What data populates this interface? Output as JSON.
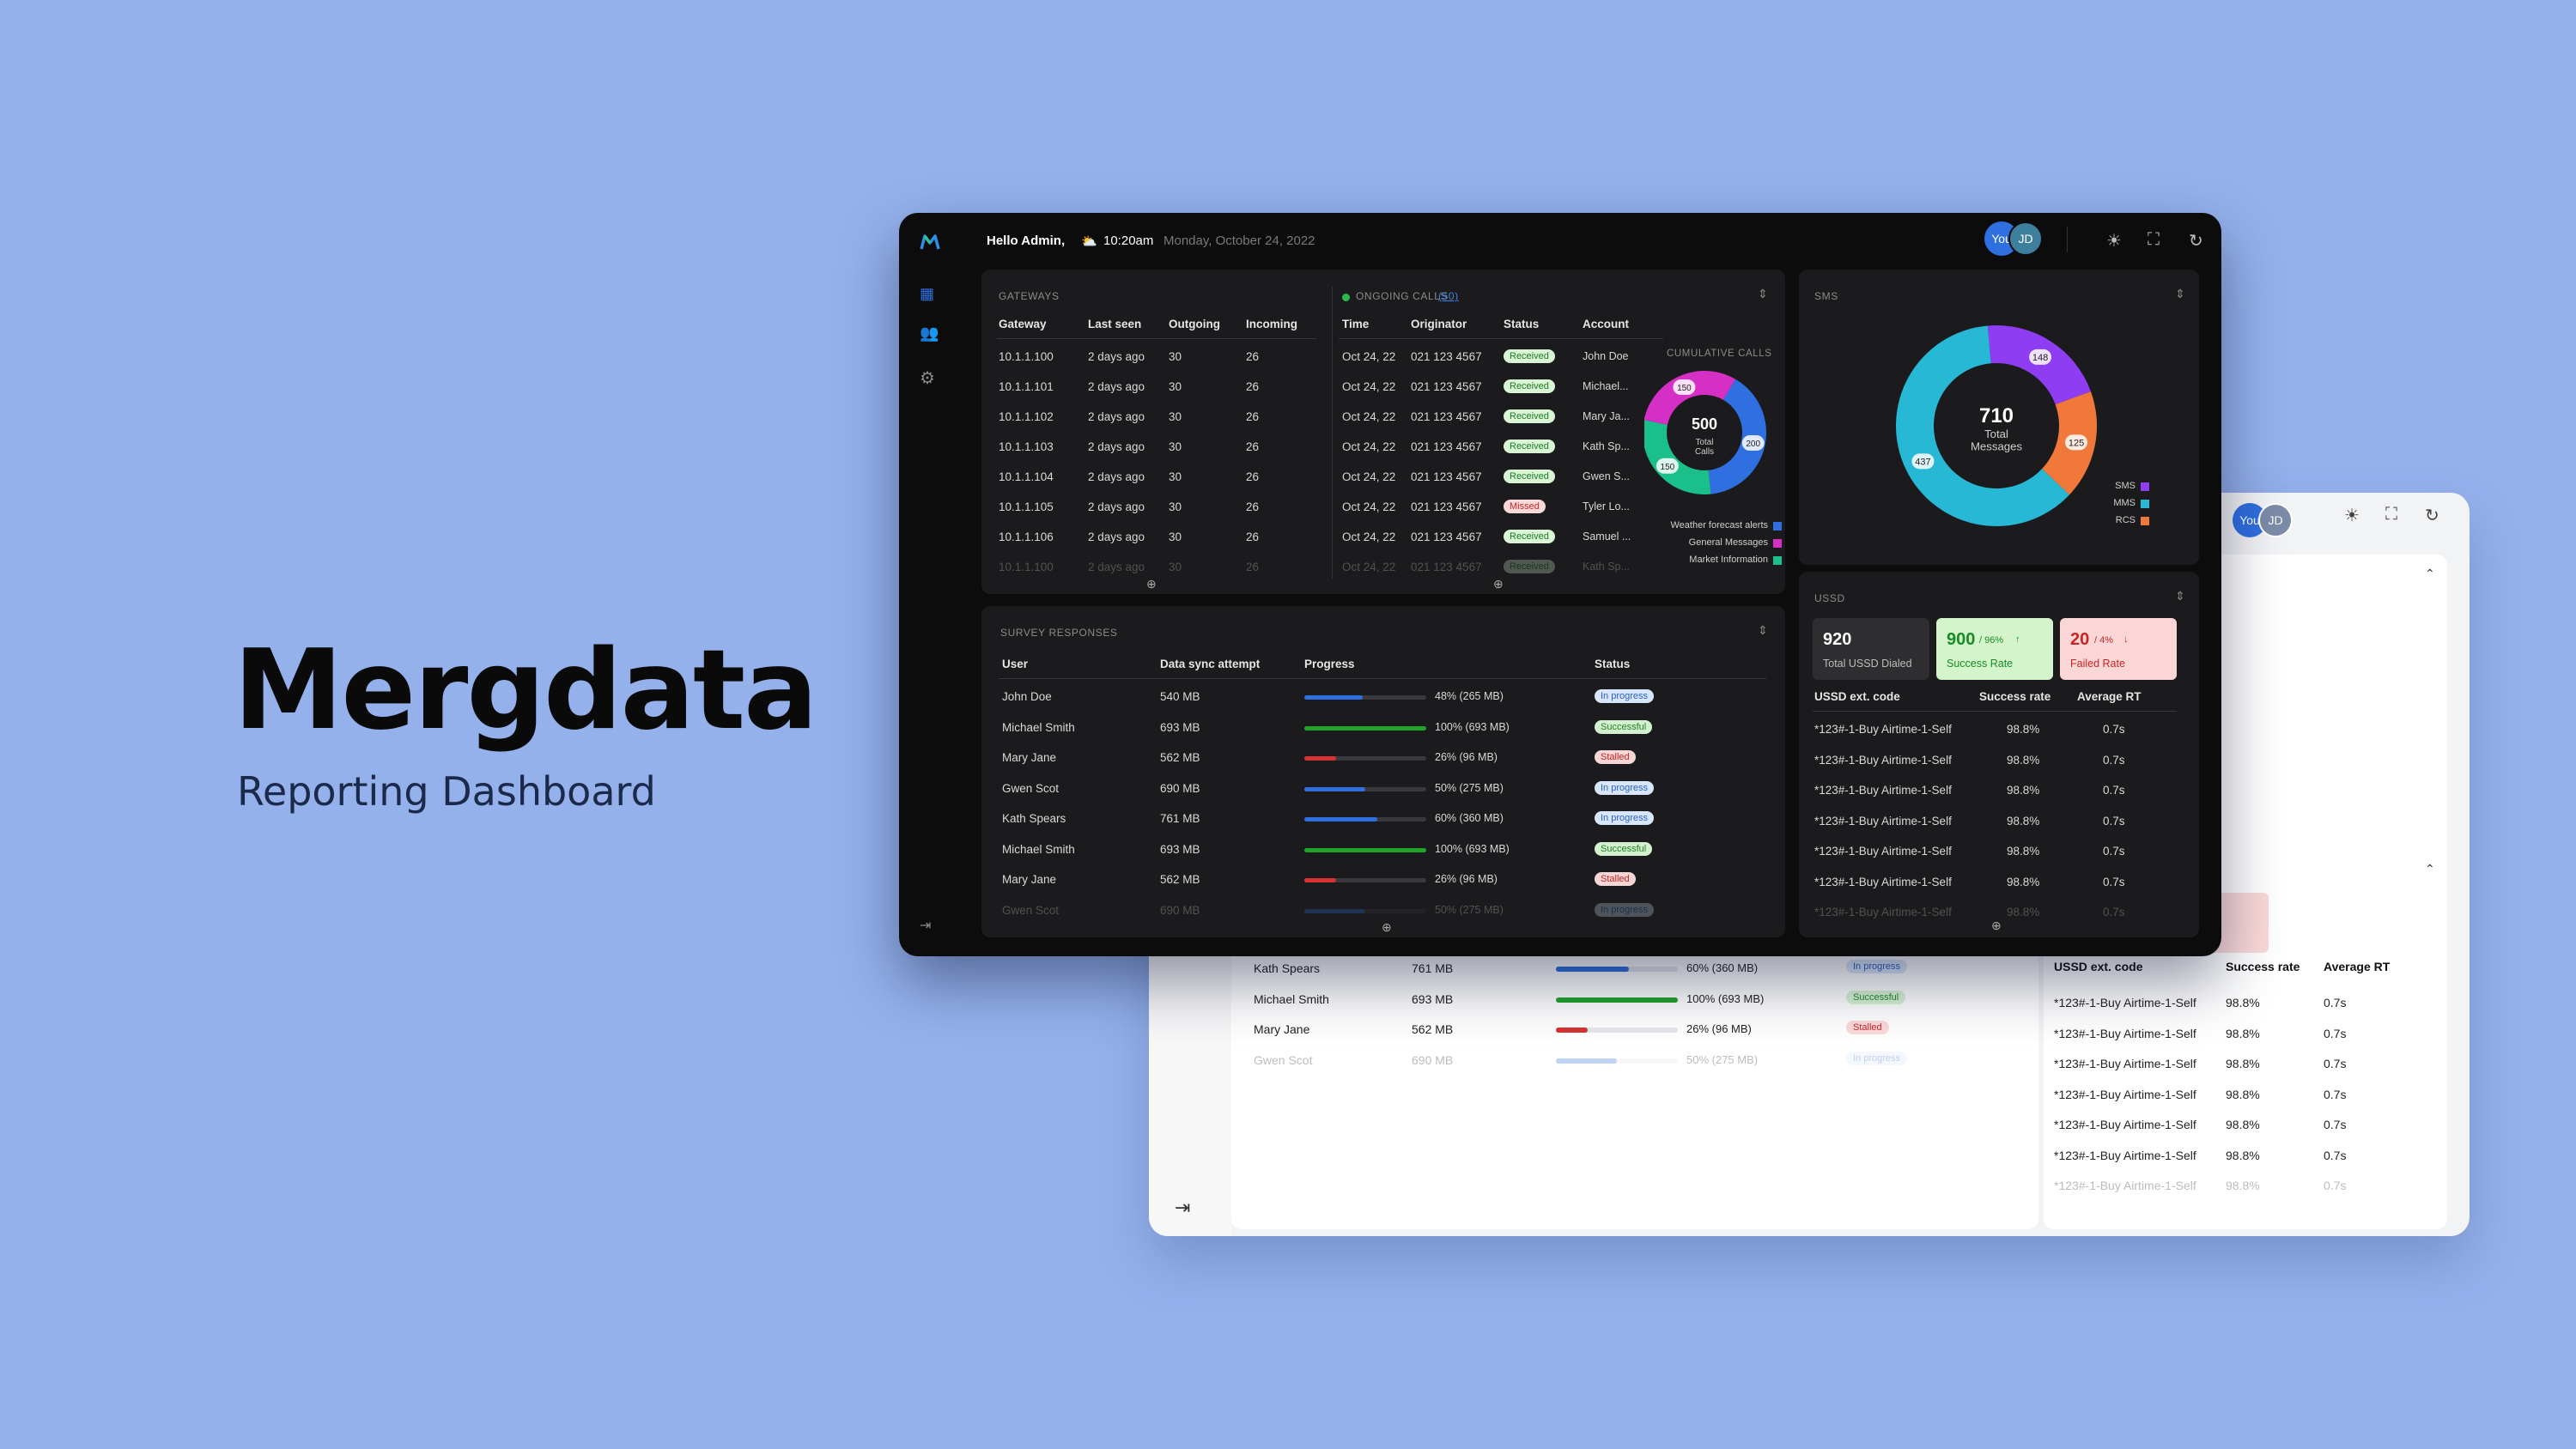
{
  "hero": {
    "title": "Mergdata",
    "subtitle": "Reporting Dashboard"
  },
  "header": {
    "greeting": "Hello Admin,",
    "weather_icon": "⛅",
    "time": "10:20am",
    "date": "Monday, October 24, 2022",
    "avatars": [
      "You",
      "JD"
    ]
  },
  "gateways": {
    "label": "GATEWAYS",
    "columns": [
      "Gateway",
      "Last seen",
      "Outgoing",
      "Incoming"
    ],
    "rows": [
      [
        "10.1.1.100",
        "2 days ago",
        "30",
        "26"
      ],
      [
        "10.1.1.101",
        "2 days ago",
        "30",
        "26"
      ],
      [
        "10.1.1.102",
        "2 days ago",
        "30",
        "26"
      ],
      [
        "10.1.1.103",
        "2 days ago",
        "30",
        "26"
      ],
      [
        "10.1.1.104",
        "2 days ago",
        "30",
        "26"
      ],
      [
        "10.1.1.105",
        "2 days ago",
        "30",
        "26"
      ],
      [
        "10.1.1.106",
        "2 days ago",
        "30",
        "26"
      ],
      [
        "10.1.1.100",
        "2 days ago",
        "30",
        "26"
      ]
    ]
  },
  "calls": {
    "label": "ONGOING CALLS",
    "count": "(50)",
    "columns": [
      "Time",
      "Originator",
      "Status",
      "Account"
    ],
    "rows": [
      [
        "Oct 24, 22",
        "021 123 4567",
        "Received",
        "John Doe"
      ],
      [
        "Oct 24, 22",
        "021 123 4567",
        "Received",
        "Michael..."
      ],
      [
        "Oct 24, 22",
        "021 123 4567",
        "Received",
        "Mary Ja..."
      ],
      [
        "Oct 24, 22",
        "021 123 4567",
        "Received",
        "Kath Sp..."
      ],
      [
        "Oct 24, 22",
        "021 123 4567",
        "Received",
        "Gwen S..."
      ],
      [
        "Oct 24, 22",
        "021 123 4567",
        "Missed",
        "Tyler Lo..."
      ],
      [
        "Oct 24, 22",
        "021 123 4567",
        "Received",
        "Samuel ..."
      ],
      [
        "Oct 24, 22",
        "021 123 4567",
        "Received",
        "Kath Sp..."
      ]
    ],
    "cumulative": {
      "label": "CUMULATIVE CALLS",
      "total": "500",
      "total_label": "Total Calls",
      "segments": [
        {
          "name": "Weather forecast alerts",
          "value": 200,
          "color": "#2f6fe0"
        },
        {
          "name": "General Messages",
          "value": 150,
          "color": "#d62fc6"
        },
        {
          "name": "Market Information",
          "value": 150,
          "color": "#1bbf8a"
        }
      ]
    }
  },
  "sms": {
    "label": "SMS",
    "total": "710",
    "total_label": "Total Messages",
    "segments": [
      {
        "name": "SMS",
        "value": 148,
        "color": "#8f3df2"
      },
      {
        "name": "MMS",
        "value": 437,
        "color": "#27b8d6"
      },
      {
        "name": "RCS",
        "value": 125,
        "color": "#f0783a"
      }
    ]
  },
  "survey": {
    "label": "SURVEY RESPONSES",
    "columns": [
      "User",
      "Data sync attempt",
      "Progress",
      "Status"
    ],
    "rows": [
      {
        "user": "John Doe",
        "size": "540 MB",
        "pct": 48,
        "progress": "48% (265 MB)",
        "status": "In progress",
        "kind": "prog"
      },
      {
        "user": "Michael Smith",
        "size": "693 MB",
        "pct": 100,
        "progress": "100% (693 MB)",
        "status": "Successful",
        "kind": "succ"
      },
      {
        "user": "Mary Jane",
        "size": "562 MB",
        "pct": 26,
        "progress": "26% (96 MB)",
        "status": "Stalled",
        "kind": "stall"
      },
      {
        "user": "Gwen Scot",
        "size": "690 MB",
        "pct": 50,
        "progress": "50% (275 MB)",
        "status": "In progress",
        "kind": "prog"
      },
      {
        "user": "Kath Spears",
        "size": "761 MB",
        "pct": 60,
        "progress": "60% (360 MB)",
        "status": "In progress",
        "kind": "prog"
      },
      {
        "user": "Michael Smith",
        "size": "693 MB",
        "pct": 100,
        "progress": "100% (693 MB)",
        "status": "Successful",
        "kind": "succ"
      },
      {
        "user": "Mary Jane",
        "size": "562 MB",
        "pct": 26,
        "progress": "26% (96 MB)",
        "status": "Stalled",
        "kind": "stall"
      },
      {
        "user": "Gwen Scot",
        "size": "690 MB",
        "pct": 50,
        "progress": "50% (275 MB)",
        "status": "In progress",
        "kind": "prog"
      }
    ]
  },
  "ussd": {
    "label": "USSD",
    "dialed": {
      "value": "920",
      "label": "Total USSD Dialed"
    },
    "success": {
      "value": "900",
      "pct": "/ 96%",
      "arrow": "↑",
      "label": "Success Rate"
    },
    "failed": {
      "value": "20",
      "pct": "/ 4%",
      "arrow": "↓",
      "label": "Failed Rate"
    },
    "columns": [
      "USSD ext. code",
      "Success rate",
      "Average RT"
    ],
    "rows": [
      [
        "*123#-1-Buy Airtime-1-Self",
        "98.8%",
        "0.7s"
      ],
      [
        "*123#-1-Buy Airtime-1-Self",
        "98.8%",
        "0.7s"
      ],
      [
        "*123#-1-Buy Airtime-1-Self",
        "98.8%",
        "0.7s"
      ],
      [
        "*123#-1-Buy Airtime-1-Self",
        "98.8%",
        "0.7s"
      ],
      [
        "*123#-1-Buy Airtime-1-Self",
        "98.8%",
        "0.7s"
      ],
      [
        "*123#-1-Buy Airtime-1-Self",
        "98.8%",
        "0.7s"
      ],
      [
        "*123#-1-Buy Airtime-1-Self",
        "98.8%",
        "0.7s"
      ]
    ]
  },
  "colors": {
    "background": "#95b1ec",
    "accent_blue": "#2f6fe0",
    "success_green": "#22a32a",
    "error_red": "#d93232"
  }
}
